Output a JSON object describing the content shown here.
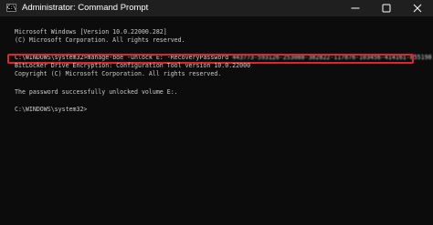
{
  "window": {
    "title": "Administrator: Command Prompt",
    "icon_text": "C:\\",
    "icon": "command-prompt-icon",
    "buttons": [
      "minimize-icon",
      "maximize-icon",
      "close-icon"
    ]
  },
  "terminal": {
    "banner_line1": "Microsoft Windows [Version 10.0.22000.282]",
    "banner_line2": "(C) Microsoft Corporation. All rights reserved.",
    "command_prompt": "C:\\WINDOWS\\system32>",
    "command_text": "manage-bde -unlock E: -RecoveryPassword ",
    "recovery_password": "443773-593126-253088-382822-117876-103456-414161-855198",
    "output_line1": "BitLocker Drive Encryption: Configuration Tool version 10.0.22000",
    "output_line2": "Copyright (C) Microsoft Corporation. All rights reserved.",
    "output_line3": "The password successfully unlocked volume E:.",
    "final_prompt": "C:\\WINDOWS\\system32>"
  },
  "colors": {
    "terminal_bg": "#0c0c0c",
    "titlebar_bg": "#1f1f1f",
    "text": "#cccccc",
    "highlight": "#e0242a"
  }
}
